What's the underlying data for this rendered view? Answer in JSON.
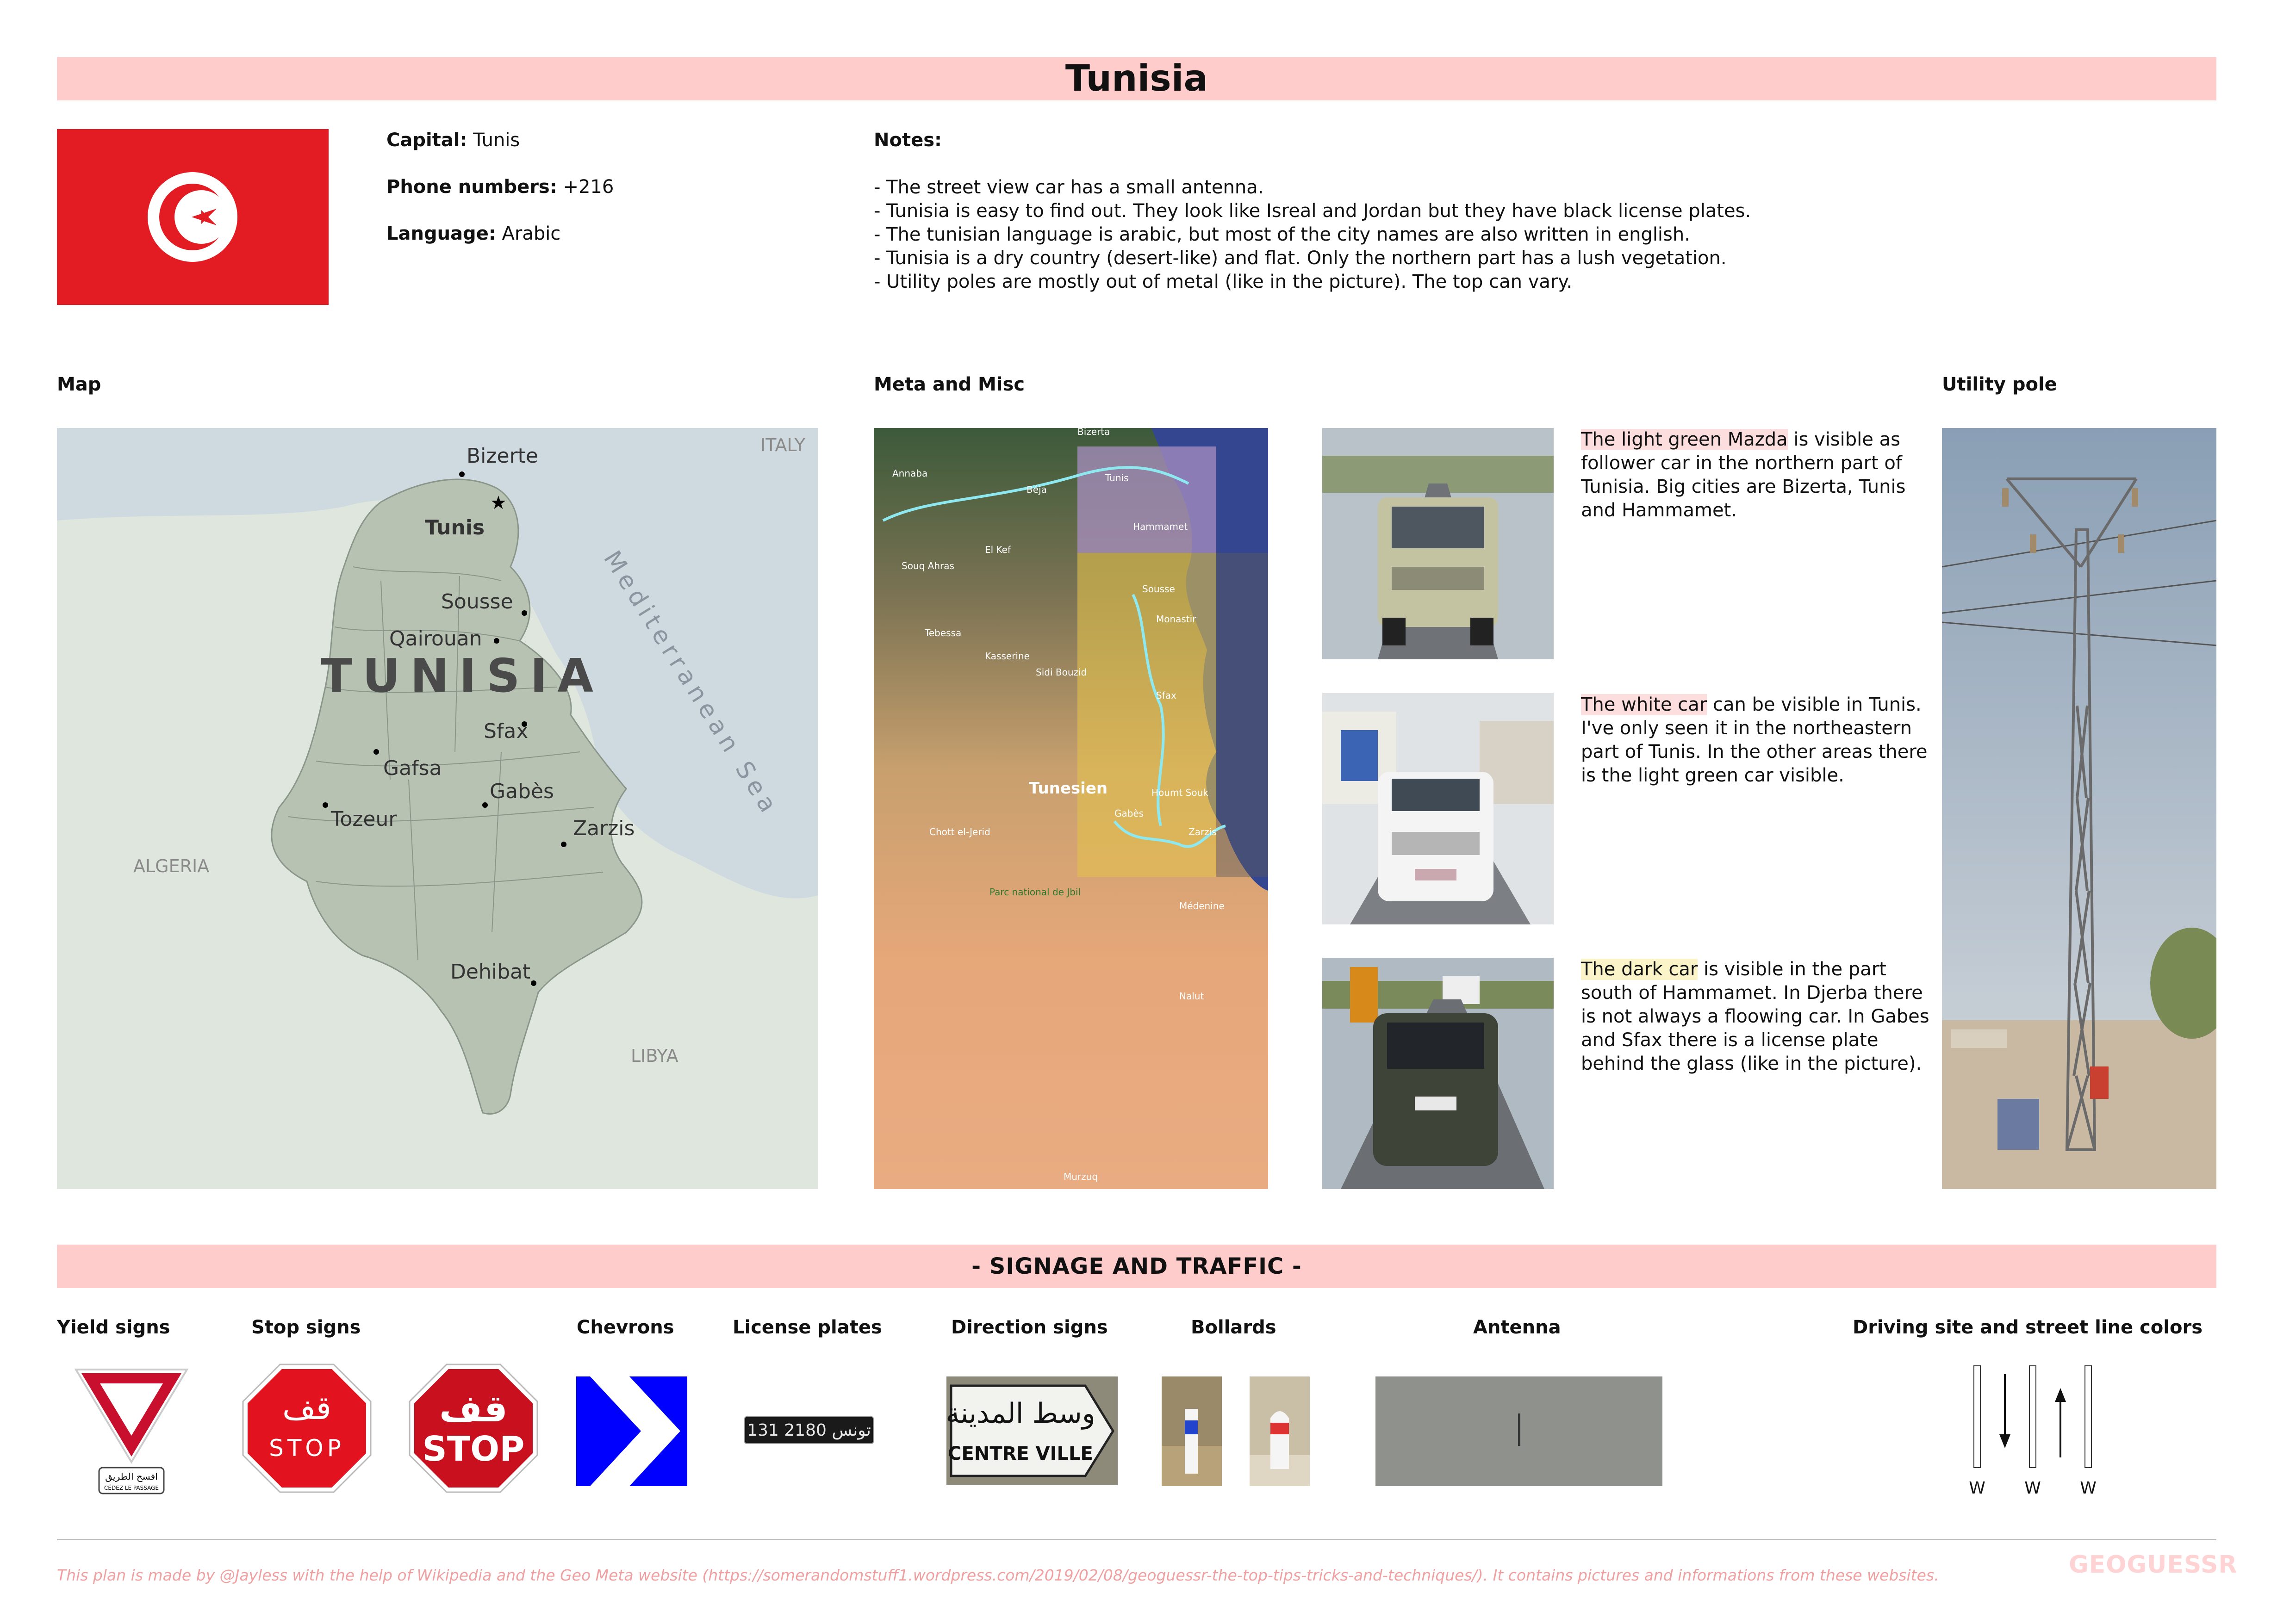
{
  "title": "Tunisia",
  "info": {
    "capital_label": "Capital:",
    "capital_value": "Tunis",
    "phone_label": "Phone numbers:",
    "phone_value": "+216",
    "language_label": "Language:",
    "language_value": "Arabic"
  },
  "notes": {
    "heading": "Notes:",
    "items": [
      "- The street view car has a small antenna.",
      "- Tunisia is easy to find out. They look like Isreal and Jordan but they have black license plates.",
      "- The tunisian language is arabic, but most of the city names are also written in english.",
      "- Tunisia is a dry country (desert-like) and flat. Only the northern part has a lush vegetation.",
      "- Utility poles are mostly out of metal (like in the picture). The top can vary."
    ]
  },
  "sections": {
    "map": "Map",
    "meta": "Meta and Misc",
    "utility": "Utility pole"
  },
  "map": {
    "country": "TUNISIA",
    "sea": "Mediterranean Sea",
    "neighbors": {
      "algeria": "ALGERIA",
      "libya": "LIBYA",
      "italy": "ITALY"
    },
    "cities": [
      "Bizerte",
      "Tunis",
      "Sousse",
      "Qairouan",
      "Sfax",
      "Gafsa",
      "Gabès",
      "Tozeur",
      "Zarzis",
      "Dehibat"
    ]
  },
  "meta_map": {
    "labels": [
      "Bizerta",
      "Annaba",
      "Tunis",
      "Hammamet",
      "Béja",
      "Souq Ahras",
      "El Kef",
      "Sousse",
      "Monastir",
      "Tebessa",
      "Kasserine",
      "Sidi Bouzid",
      "Sfax",
      "Tunesien",
      "Houmt Souk",
      "Gabès",
      "Zarzis",
      "Chott el-Jerid",
      "Parc national de Jbil",
      "Médenine",
      "Nalut",
      "Murzuq"
    ]
  },
  "cars": [
    {
      "highlight": "The light green Mazda",
      "text": " is visible as follower car in the northern part of Tunisia. Big cities are Bizerta, Tunis and Hammamet."
    },
    {
      "highlight": "The white car",
      "text": " can be visible in Tunis. I've only seen it in the northeastern part of Tunis. In the other areas there is the light green car visible."
    },
    {
      "highlight": "The dark car",
      "text": " is visible in the part south of Hammamet. In Djerba there is not always a floowing car. In Gabes and Sfax there is a license plate behind the glass (like in the picture)."
    }
  ],
  "signage": {
    "banner": "- SIGNAGE AND TRAFFIC -",
    "headings": {
      "yield": "Yield signs",
      "stop": "Stop signs",
      "chevrons": "Chevrons",
      "plates": "License plates",
      "direction": "Direction signs",
      "bollards": "Bollards",
      "antenna": "Antenna",
      "driving": "Driving site and street line colors"
    },
    "yield_text_ar": "افسح الطريق",
    "yield_text_fr": "CÉDEZ LE PASSAGE",
    "stop_ar": "قف",
    "stop_en": "STOP",
    "plate_text": "131 تونس 2180",
    "direction_ar": "وسط المدينة",
    "direction_fr": "CENTRE VILLE",
    "lane_labels": [
      "W",
      "W",
      "W"
    ]
  },
  "colors": {
    "banner": "#ffcccc",
    "flag_red": "#e31b23",
    "chevron_blue": "#0000ff",
    "footer_text": "#f0a0a0"
  },
  "footer": {
    "text": "This plan is made by @Jayless with the help of Wikipedia and the Geo Meta website (https://somerandomstuff1.wordpress.com/2019/02/08/geoguessr-the-top-tips-tricks-and-techniques/). It contains pictures and informations from these websites.",
    "logo": "GEOGUESSR"
  }
}
